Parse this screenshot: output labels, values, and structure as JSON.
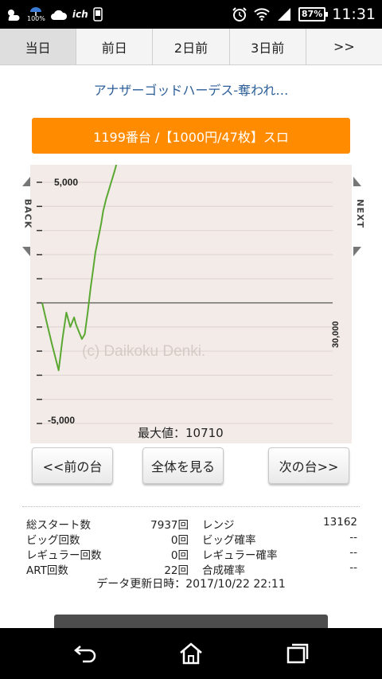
{
  "status_bar": {
    "battery": "87%",
    "time": "11:31",
    "umbrella_percent": "100%",
    "carrier": "ich"
  },
  "tabs": [
    {
      "label": "当日"
    },
    {
      "label": "前日"
    },
    {
      "label": "2日前"
    },
    {
      "label": "3日前"
    },
    {
      "label": ">>"
    }
  ],
  "machine_title": "アナザーゴッドハーデス-奪われ…",
  "machine_info": "1199番台 /【1000円/47枚】スロ",
  "graph": {
    "back_label": "BACK",
    "next_label": "NEXT",
    "watermark": "(c) Daikoku Denki.",
    "max_label": "最大値：10710",
    "y_top_label": "5,000",
    "y_bottom_label": "-5,000",
    "x_right_label": "30,000"
  },
  "chart_data": {
    "type": "line",
    "xlabel": "",
    "ylabel": "",
    "xlim": [
      0,
      30000
    ],
    "ylim": [
      -5000,
      5000
    ],
    "grid": true,
    "series": [
      {
        "color": "#5aa832",
        "x": [
          0,
          400,
          1000,
          1700,
          2100,
          2500,
          2900,
          3300,
          3500,
          3800,
          4100,
          4400,
          4700,
          5000,
          5300,
          5500,
          5800,
          6100,
          6300,
          6600,
          6900,
          7200,
          7500,
          7700,
          7937
        ],
        "y": [
          0,
          -700,
          -1700,
          -2800,
          -1500,
          -400,
          -1000,
          -600,
          -900,
          -1200,
          -1500,
          -1300,
          -400,
          600,
          1500,
          2100,
          2700,
          3300,
          3800,
          4300,
          4700,
          5100,
          5500,
          5800,
          6300
        ]
      }
    ]
  },
  "buttons": {
    "prev": "<<前の台",
    "all": "全体を見る",
    "next": "次の台>>"
  },
  "stats": {
    "rows": [
      {
        "label1": "総スタート数",
        "value1": "7937回",
        "label2": "レンジ",
        "value2": "13162"
      },
      {
        "label1": "ビッグ回数",
        "value1": "0回",
        "label2": "ビッグ確率",
        "value2": "--"
      },
      {
        "label1": "レギュラー回数",
        "value1": "0回",
        "label2": "レギュラー確率",
        "value2": "--"
      },
      {
        "label1": "ART回数",
        "value1": "22回",
        "label2": "合成確率",
        "value2": "--"
      }
    ],
    "updated": "データ更新日時：2017/10/22 22:11"
  },
  "colors": {
    "orange": "#ff8c00",
    "title_blue": "#2c5f99",
    "graph_bg": "#f3ebe7",
    "line_green": "#5aa832"
  }
}
